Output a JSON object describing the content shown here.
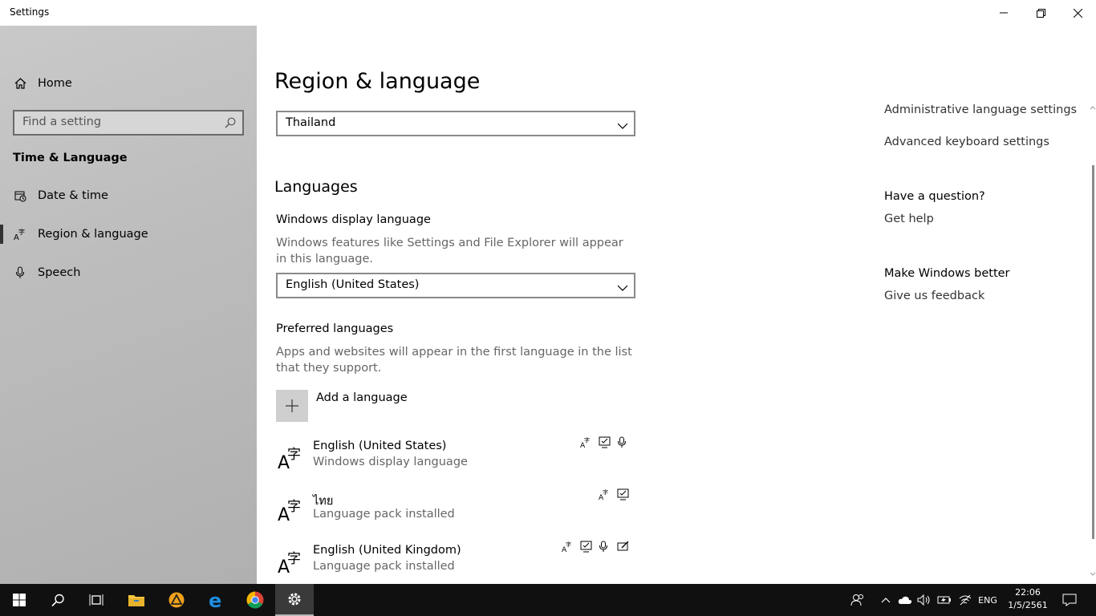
{
  "window": {
    "title": "Settings"
  },
  "sidebar": {
    "home_label": "Home",
    "search_placeholder": "Find a setting",
    "section_title": "Time & Language",
    "items": [
      {
        "label": "Date & time",
        "icon": "calendar-clock-icon"
      },
      {
        "label": "Region & language",
        "icon": "language-icon",
        "selected": true
      },
      {
        "label": "Speech",
        "icon": "microphone-icon"
      }
    ]
  },
  "main": {
    "page_title": "Region & language",
    "country_select_value": "Thailand",
    "languages_heading": "Languages",
    "display_language": {
      "heading": "Windows display language",
      "description": "Windows features like Settings and File Explorer will appear in this language.",
      "value": "English (United States)"
    },
    "preferred": {
      "heading": "Preferred languages",
      "description": "Apps and websites will appear in the first language in the list that they support.",
      "add_label": "Add a language",
      "languages": [
        {
          "name": "English (United States)",
          "status": "Windows display language",
          "features": [
            "language-pack-icon",
            "text-to-speech-icon",
            "speech-icon"
          ]
        },
        {
          "name": "ไทย",
          "status": "Language pack installed",
          "features": [
            "language-pack-icon",
            "text-to-speech-icon"
          ]
        },
        {
          "name": "English (United Kingdom)",
          "status": "Language pack installed",
          "features": [
            "language-pack-icon",
            "text-to-speech-icon",
            "speech-icon",
            "handwriting-icon"
          ]
        }
      ]
    }
  },
  "right_panel": {
    "link_admin": "Administrative language settings",
    "link_keyboard": "Advanced keyboard settings",
    "question_heading": "Have a question?",
    "get_help": "Get help",
    "better_heading": "Make Windows better",
    "feedback": "Give us feedback"
  },
  "taskbar": {
    "input_language": "ENG",
    "time": "22:06",
    "date": "1/5/2561"
  }
}
